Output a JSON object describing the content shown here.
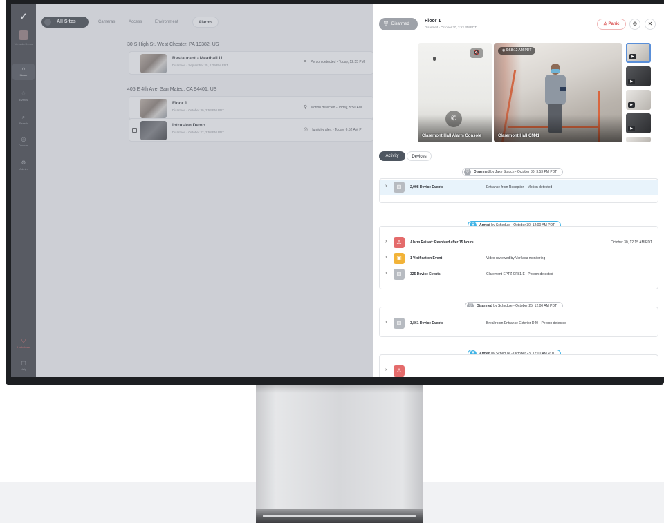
{
  "sidebar": {
    "logo": "✓",
    "org_label": "Verkada Demo",
    "items": [
      {
        "icon": "home-icon",
        "glyph": "⌂",
        "label": "Home"
      },
      {
        "icon": "bell-icon",
        "glyph": "♢",
        "label": "Events"
      },
      {
        "icon": "search-icon",
        "glyph": "⌕",
        "label": "Search"
      },
      {
        "icon": "devices-icon",
        "glyph": "◎",
        "label": "Devices"
      },
      {
        "icon": "gear-icon",
        "glyph": "⚙",
        "label": "Admin"
      }
    ],
    "bottom_items": [
      {
        "icon": "lock-icon",
        "glyph": "🔒",
        "label": "Lockdown"
      },
      {
        "icon": "help-icon",
        "glyph": "▢",
        "label": "Help"
      }
    ]
  },
  "main": {
    "tabs": [
      "All Sites",
      "Cameras",
      "Access",
      "Environment",
      "Alarms"
    ],
    "sites": [
      {
        "address": "30 S High St, West Chester, PA 19382, US",
        "items": [
          {
            "name": "Restaurant - Meatball U",
            "status": "Disarmed - September 25, 1:29 PM EDT",
            "event": "Person detected - Today, 12:55 PM"
          }
        ]
      },
      {
        "address": "405 E 4th Ave, San Mateo, CA 94401, US",
        "items": [
          {
            "name": "Floor 1",
            "status": "Disarmed - October 30, 3:53 PM PDT",
            "event": "Motion detected - Today, 5:50 AM"
          },
          {
            "name": "Intrusion Demo",
            "status": "Disarmed - October 27, 3:58 PM PDT",
            "event": "Humidity alert - Today, 6:52 AM P"
          }
        ]
      }
    ]
  },
  "panel": {
    "status": "Disarmed",
    "title": "Floor 1",
    "subtitle": "Disarmed - October 30, 3:53 PM PDT",
    "panic_label": "Panic",
    "cameras": [
      {
        "label": "Claremont Hall Alarm Console"
      },
      {
        "label": "Claremont Hall CM41",
        "time": "9:58:12 AM PDT"
      }
    ],
    "segments": [
      "Activity",
      "Devices"
    ],
    "timeline": [
      {
        "marker_bold": "Disarmed",
        "marker_rest": "by Jake Stauch - October 30, 3:53 PM PDT",
        "type": "disarmed",
        "rows": [
          {
            "title": "2,098 Device Events",
            "desc": "Entrance from Reception - Motion detected",
            "time": "",
            "icon": "gray"
          }
        ]
      },
      {
        "marker_bold": "Armed",
        "marker_rest": "by Schedule - October 30, 12:00 AM PDT",
        "type": "armed",
        "rows": [
          {
            "title": "Alarm Raised: Resolved after 15 hours",
            "desc": "",
            "time": "October 30, 12:15 AM PDT",
            "icon": "red"
          },
          {
            "title": "1 Verification Event",
            "desc": "Video reviewed by Verkada monitoring",
            "time": "",
            "icon": "yellow"
          },
          {
            "title": "325 Device Events",
            "desc": "Claremont EPTZ CF81-E - Person detected",
            "time": "",
            "icon": "gray"
          }
        ]
      },
      {
        "marker_bold": "Disarmed",
        "marker_rest": "by Schedule - October 25, 12:00 AM PDT",
        "type": "disarmed",
        "rows": [
          {
            "title": "3,861 Device Events",
            "desc": "Breakroom Entrance Exterior D40 - Person detected",
            "time": "",
            "icon": "gray"
          }
        ]
      },
      {
        "marker_bold": "Armed",
        "marker_rest": "by Schedule - October 23, 12:00 AM PDT",
        "type": "armed",
        "rows": []
      }
    ]
  }
}
